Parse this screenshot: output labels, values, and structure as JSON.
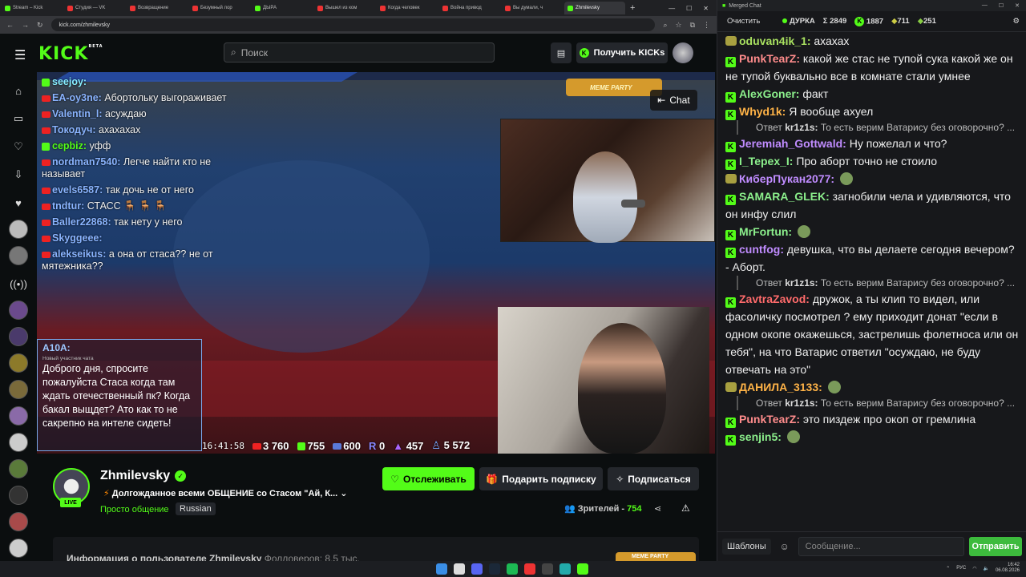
{
  "browser": {
    "tabs": [
      {
        "label": "Stream – Kick",
        "color": "#53fc18"
      },
      {
        "label": "Студия — VK",
        "color": "#e33"
      },
      {
        "label": "Возвращение",
        "color": "#e33"
      },
      {
        "label": "Безумный лор",
        "color": "#e33"
      },
      {
        "label": "ДЫРА",
        "color": "#53fc18"
      },
      {
        "label": "Вышел из ком",
        "color": "#e33"
      },
      {
        "label": "Когда человек",
        "color": "#e33"
      },
      {
        "label": "Война привод",
        "color": "#e33"
      },
      {
        "label": "Вы думали, ч",
        "color": "#e33"
      },
      {
        "label": "Zhmilevsky",
        "color": "#53fc18",
        "active": true
      }
    ],
    "url": "kick.com/zhmilevsky"
  },
  "header": {
    "logo": "KICK",
    "logo_sup": "BETA",
    "search_placeholder": "Поиск",
    "get_kicks": "Получить KICKs"
  },
  "stream": {
    "chat_button": "Chat",
    "meme_party": "MEME PARTY",
    "overlay_chat": [
      {
        "user": "seejoy:",
        "text": "",
        "color": "#8ef",
        "src": "kick"
      },
      {
        "user": "EA-oy3ne:",
        "text": "Абортольку выгораживает",
        "color": "#8ab4ff",
        "src": "yt"
      },
      {
        "user": "Valentin_l:",
        "text": "асуждаю",
        "color": "#8ab4ff",
        "src": "yt"
      },
      {
        "user": "Токодуч:",
        "text": "ахахахах",
        "color": "#8ab4ff",
        "src": "yt"
      },
      {
        "user": "cepbiz:",
        "text": "уфф",
        "color": "#53fc18",
        "src": "kick"
      },
      {
        "user": "nordman7540:",
        "text": "Легче найти кто не называет",
        "color": "#8ab4ff",
        "src": "yt"
      },
      {
        "user": "evels6587:",
        "text": "так дочь не от него",
        "color": "#8ab4ff",
        "src": "yt"
      },
      {
        "user": "tndtur:",
        "text": "СТАСС 🪑 🪑 🪑",
        "color": "#8ab4ff",
        "src": "yt"
      },
      {
        "user": "Baller22868:",
        "text": "так нету у него",
        "color": "#8ab4ff",
        "src": "yt"
      },
      {
        "user": "Skyggeee:",
        "text": "",
        "color": "#8ab4ff",
        "src": "yt"
      },
      {
        "user": "alekseikus:",
        "text": "а она от стаса?? не от мятежника??",
        "color": "#8ab4ff",
        "src": "yt"
      }
    ],
    "donation": {
      "name": "A10A:",
      "subtitle": "Новый участник чата",
      "text": "Доброго дня, спросите пожалуйста Стаса когда там ждать отечественный пк? Когда бакал выщдет? Ато как то не сакрепно на интеле сидеть!"
    },
    "stats": {
      "time": "16:41:58",
      "yt": "3 760",
      "kick": "755",
      "vk": "600",
      "r": "0",
      "tw": "457",
      "total": "5 572"
    }
  },
  "channel": {
    "name": "Zhmilevsky",
    "live": "LIVE",
    "title": "Долгожданное всеми ОБЩЕНИЕ со Стасом \"Ай, К...",
    "category": "Просто общение",
    "tag": "Russian",
    "follow": "Отслеживать",
    "gift": "Подарить подписку",
    "subscribe": "Подписаться",
    "viewers_label": "Зрителей -",
    "viewers": "754",
    "about": "Информация о пользователе Zhmilevsky",
    "followers_label": "Фолловеров: 8,5 тыс."
  },
  "right_chat": {
    "window_title": "Merged Chat",
    "clear": "Очистить",
    "channel": "ДУРКА",
    "sigma": "Σ 2849",
    "k": "1887",
    "v1": "711",
    "v2": "251",
    "messages": [
      {
        "user": "oduvan4ik_1:",
        "text": "ахахах",
        "color": "#a8e060",
        "badge": "ss"
      },
      {
        "user": "PunkTearZ:",
        "text": "какой же стас не тупой сука какой же он не тупой буквально все в комнате стали умнее",
        "color": "#ff8c8c",
        "badge": "k"
      },
      {
        "user": "AlexGoner:",
        "text": "факт",
        "color": "#8cf08c",
        "badge": "k"
      },
      {
        "user": "Whyd1k:",
        "text": "Я вообще ахуел",
        "color": "#ffb347",
        "badge": "k"
      },
      {
        "reply_user": "kr1z1s:",
        "reply": "Ответ",
        "reply_text": "То есть верим Ватарису без оговорочно? ..."
      },
      {
        "user": "Jeremiah_Gottwald:",
        "text": "Ну пожелал и что?",
        "color": "#c08cff",
        "badge": "k"
      },
      {
        "user": "I_Tepex_I:",
        "text": "Про аборт точно не стоило",
        "color": "#8cf08c",
        "badge": "k"
      },
      {
        "user": "КиберПукан2077:",
        "text": "",
        "color": "#c08cff",
        "badge": "ss"
      },
      {
        "user": "SAMARA_GLEK:",
        "text": "загнобили чела и удивляются, что он инфу слил",
        "color": "#8cf08c",
        "badge": "k"
      },
      {
        "user": "MrFortun:",
        "text": "",
        "color": "#8cf08c",
        "badge": "k"
      },
      {
        "user": "cuntfog:",
        "text": "девушка, что вы делаете сегодня вечером? - Аборт.",
        "color": "#c08cff",
        "badge": "k"
      },
      {
        "reply_user": "kr1z1s:",
        "reply": "Ответ",
        "reply_text": "То есть верим Ватарису без оговорочно? ..."
      },
      {
        "user": "ZavtraZavod:",
        "text": "дружок, а ты клип то видел, или фасоличку посмотрел ? ему приходит донат \"если в одном окопе окажешься, застрелишь фолетноса или он тебя\", на что Ватарис ответил \"осуждаю, не буду отвечать на это\"",
        "color": "#ff6b6b",
        "badge": "k"
      },
      {
        "user": "ДАНИЛА_3133:",
        "text": "",
        "color": "#ffb347",
        "badge": "ss"
      },
      {
        "reply_user": "kr1z1s:",
        "reply": "Ответ",
        "reply_text": "То есть верим Ватарису без оговорочно? ..."
      },
      {
        "user": "PunkTearZ:",
        "text": "это пиздеж про окоп от гремлина",
        "color": "#ff8c8c",
        "badge": "k"
      },
      {
        "user": "senjin5:",
        "text": "",
        "color": "#8cf08c",
        "badge": "k"
      }
    ],
    "templates": "Шаблоны",
    "input_placeholder": "Сообщение...",
    "send": "Отправить"
  },
  "taskbar": {
    "lang": "РУС",
    "time": "16:42",
    "date": "06.08.2026"
  }
}
